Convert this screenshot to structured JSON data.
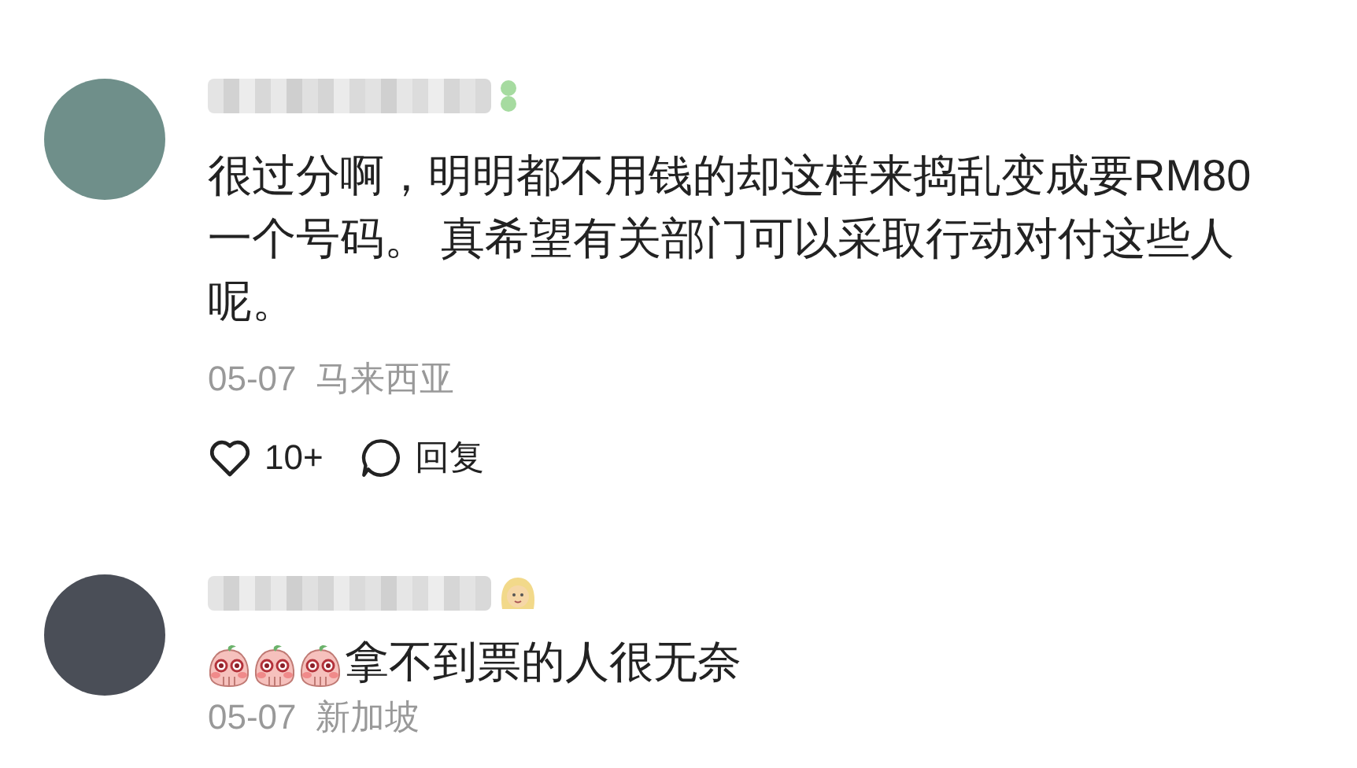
{
  "comments": [
    {
      "segments": [
        {
          "kind": "text",
          "text": "很过分啊，明明都不用钱的却这样来捣乱变成要RM80一个号码。 真希望有关部门可以采取行动对付这些人呢。"
        }
      ],
      "date": "05-07",
      "location": "马来西亚",
      "likes": "10+",
      "reply": "回复"
    },
    {
      "segments": [
        {
          "kind": "emoji"
        },
        {
          "kind": "emoji"
        },
        {
          "kind": "emoji"
        },
        {
          "kind": "text",
          "text": "拿不到票的人很无奈"
        }
      ],
      "date": "05-07",
      "location": "新加坡"
    }
  ]
}
